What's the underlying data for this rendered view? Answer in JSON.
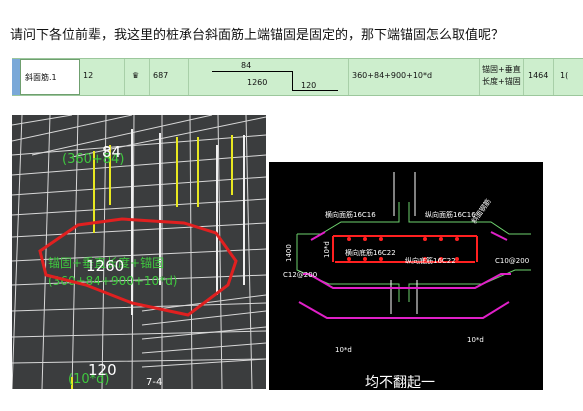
{
  "post": {
    "question": "请问下各位前辈，我这里的桩承台斜面筋上端锚固是固定的，那下端锚固怎么取值呢？"
  },
  "rebar_row": {
    "name": "斜面筋.1",
    "diameter": "12",
    "grade_symbol": "♛",
    "length": "687",
    "sketch_top": "84",
    "sketch_mid": "1260",
    "sketch_bottom": "120",
    "formula": "360+84+900+10*d",
    "description_line1": "锚固+垂直",
    "description_line2": "长度+锚固",
    "value1": "1464",
    "value2": "1("
  },
  "view3d": {
    "label_top": "84",
    "label_top_formula": "(360+84)",
    "label_mid": "1260",
    "label_mid_formula": "锚固+垂直长度+锚固",
    "label_mid_formula2": "(360+84+900+10*d)",
    "label_bottom": "120",
    "label_bottom_formula": "(10*d)",
    "label_section": "7-4"
  },
  "cad": {
    "label_top_bar": "横向面筋16C16",
    "label_long_top": "纵向面筋16C16",
    "label_bottom_bar": "横向底筋16C22",
    "label_long_bottom": "纵向底筋16C22",
    "label_slope": "斜面钢筋",
    "label_left_stirrup": "C12@200",
    "label_right_stirrup": "C10@200",
    "dim_left": "1400",
    "dim_anchor_top": "10*d",
    "dim_anchor_bottom": "10*d",
    "dim_right_anchor": "10*d",
    "caption": "均不翻起一"
  },
  "colors": {
    "table_bg": "#cdeecd",
    "cad_bg": "#000000",
    "rebar_red": "#ff2020",
    "rebar_magenta": "#e020c8",
    "outline_green": "#6ed26e",
    "label_green": "#3fc83f",
    "highlight_red": "#e02020"
  }
}
